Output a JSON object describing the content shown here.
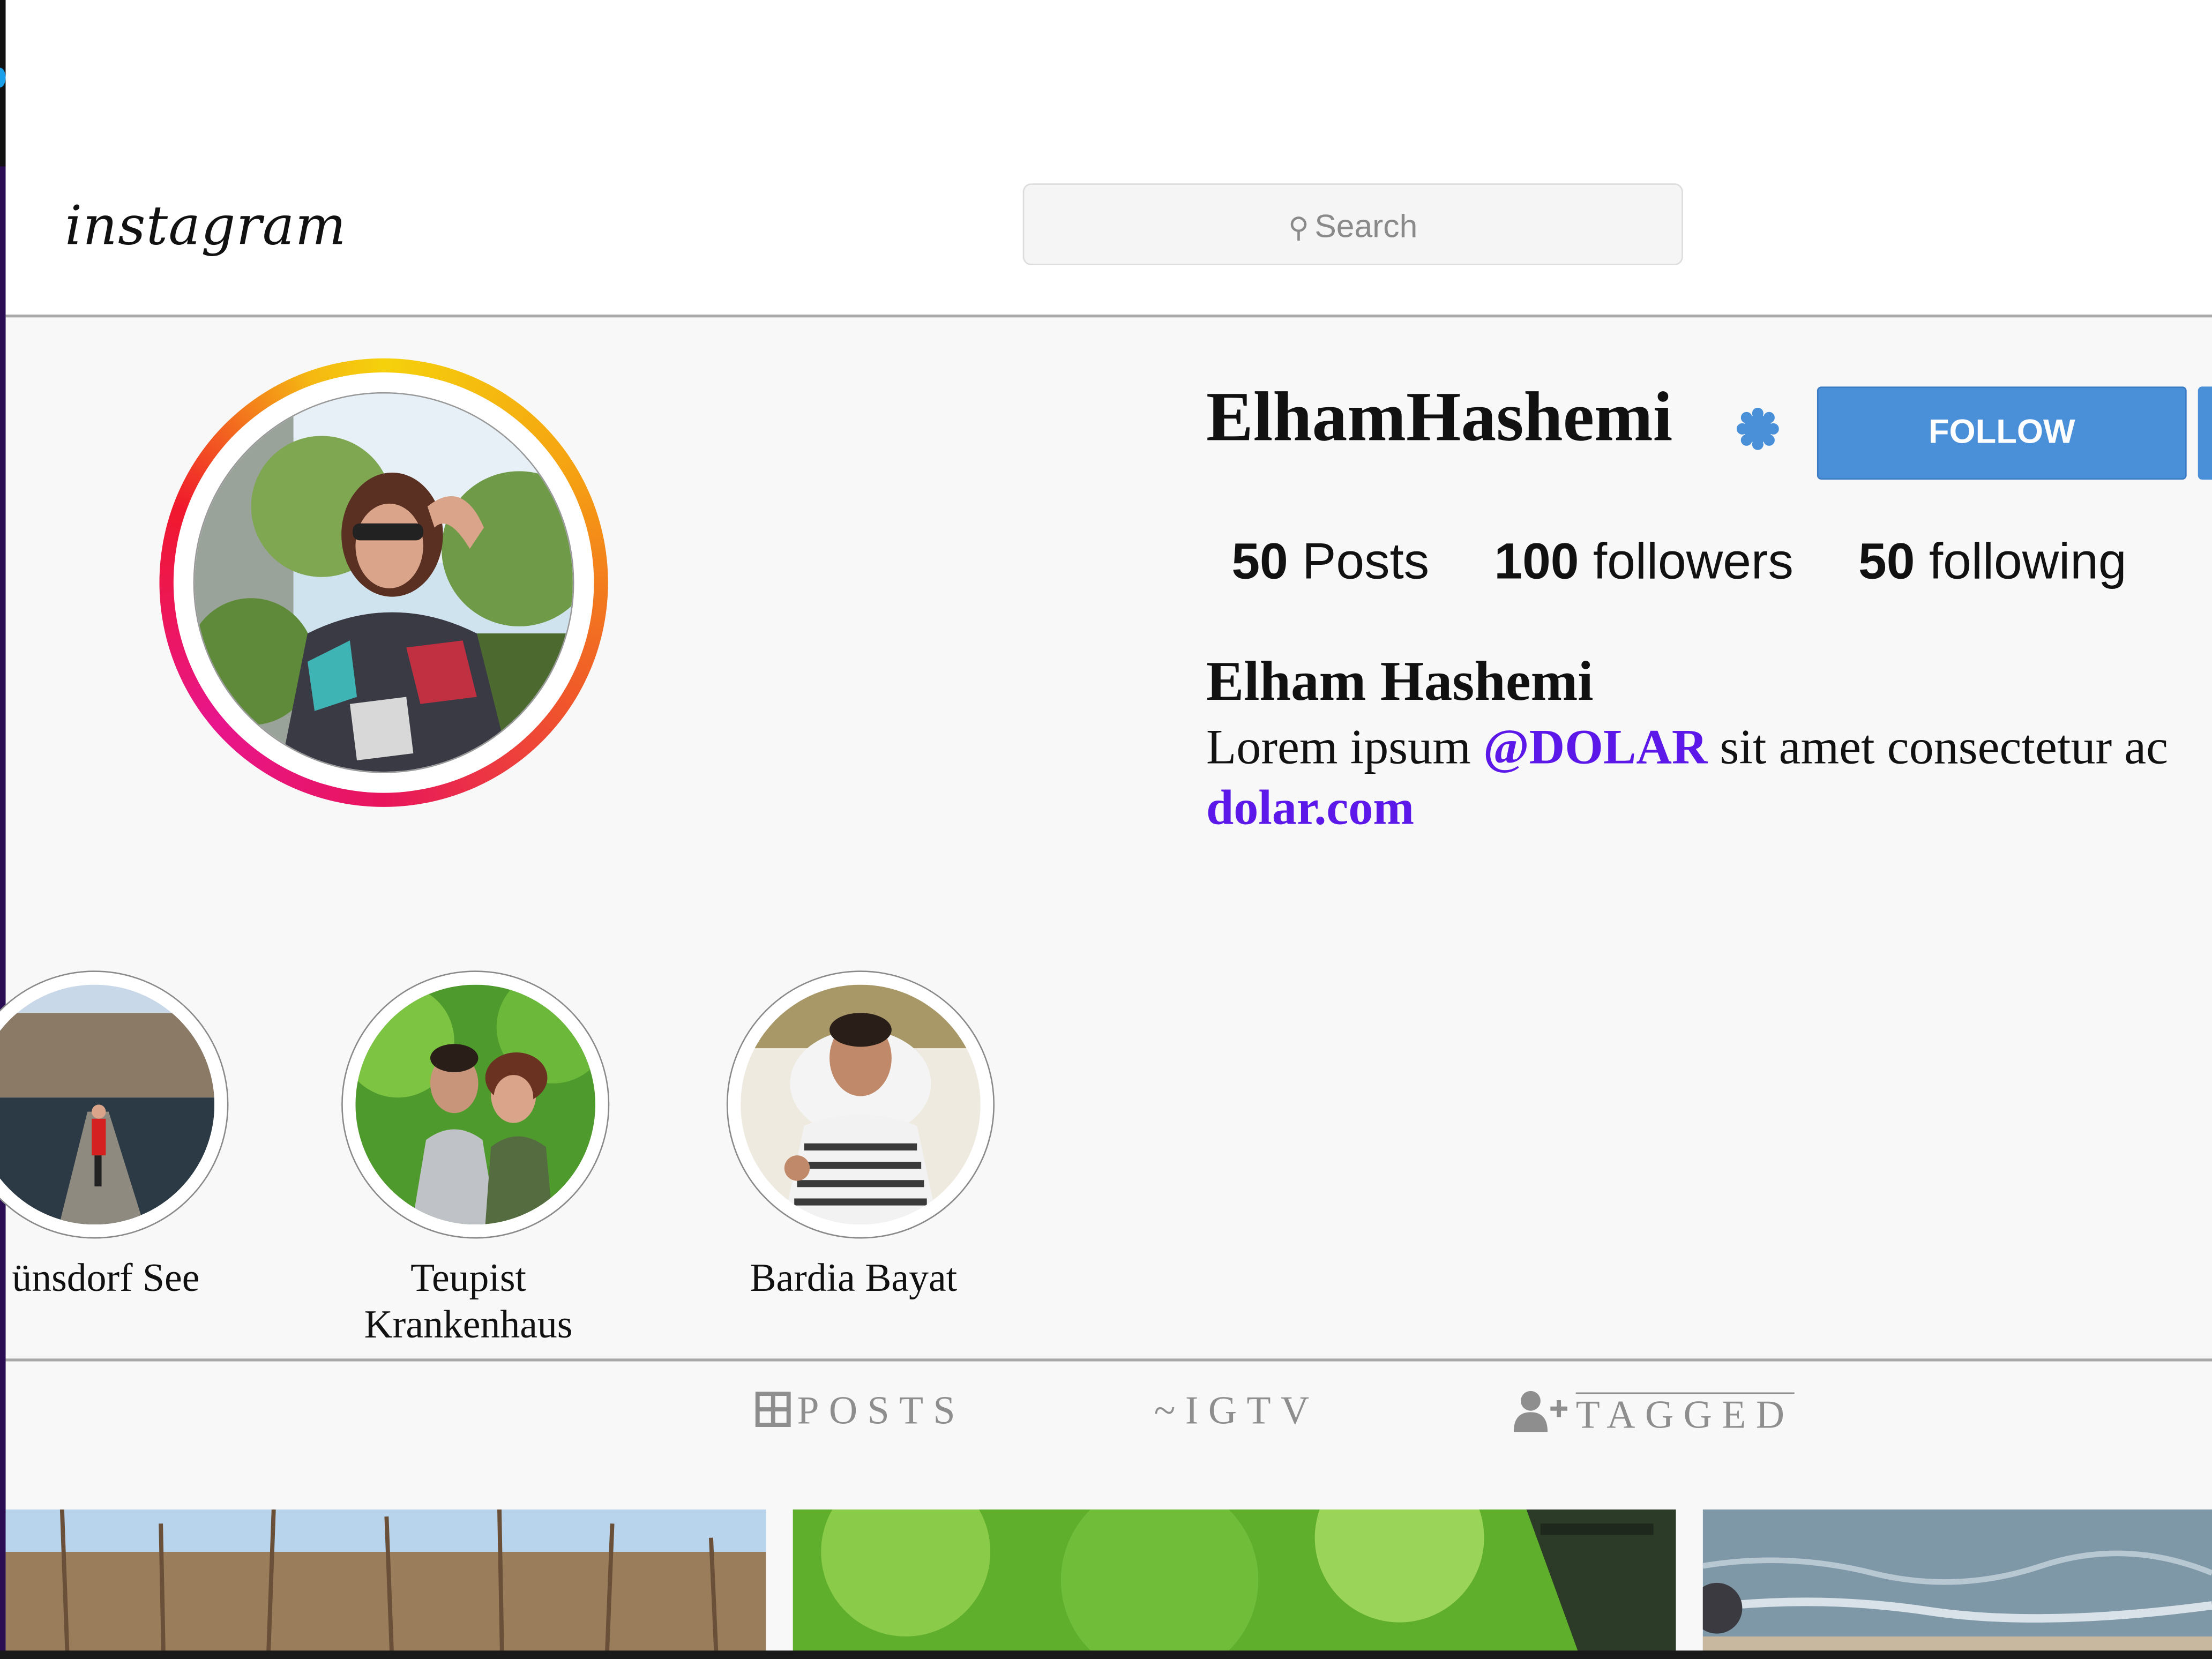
{
  "app": {
    "logo_text": "instagram"
  },
  "search": {
    "placeholder": "Search",
    "icon": "pin-icon"
  },
  "profile": {
    "username": "ElhamHashemi",
    "verified_icon": "verified-badge-icon",
    "follow_label": "FOLLOW",
    "stats": [
      {
        "value": "50",
        "label": "Posts"
      },
      {
        "value": "100",
        "label": "followers"
      },
      {
        "value": "50",
        "label": "following"
      }
    ],
    "full_name": "Elham Hashemi",
    "bio_before": "Lorem ipsum ",
    "bio_mention": "@DOLAR",
    "bio_after": " sit amet consectetur ac",
    "bio_link": "dolar.com"
  },
  "highlights": [
    {
      "label": "ünsdorf See"
    },
    {
      "label_line1": "Teupist",
      "label_line2": "Krankenhaus"
    },
    {
      "label": "Bardia Bayat"
    }
  ],
  "tabs": [
    {
      "label": "POSTS",
      "icon": "grid-icon"
    },
    {
      "label": "IGTV",
      "icon": "tilde-icon"
    },
    {
      "label": "TAGGED",
      "icon": "add-user-icon"
    }
  ],
  "colors": {
    "accent": "#4a90d9",
    "mention": "#5b18e8",
    "background": "#f8f8f8"
  }
}
